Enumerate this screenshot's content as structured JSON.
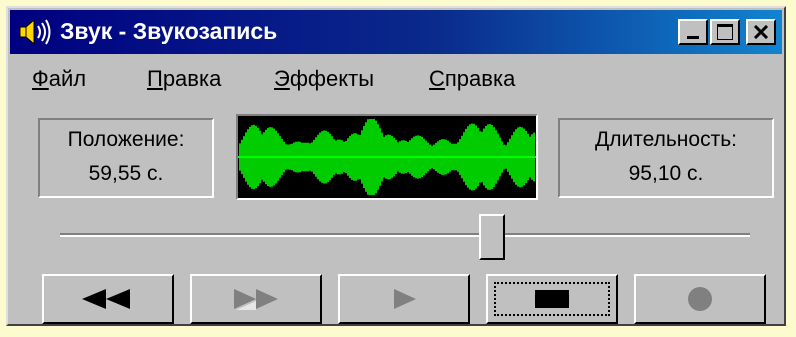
{
  "window": {
    "title": "Звук - Звукозапись",
    "controls": {
      "minimize": "minimize-icon",
      "maximize": "maximize-icon",
      "close": "close-icon"
    }
  },
  "menu": [
    {
      "accel": "Ф",
      "rest": "айл"
    },
    {
      "accel": "П",
      "rest": "равка"
    },
    {
      "accel": "Э",
      "rest": "ффекты"
    },
    {
      "accel": "С",
      "rest": "правка"
    }
  ],
  "position": {
    "label": "Положение:",
    "value": "59,55 с."
  },
  "length": {
    "label": "Длительность:",
    "value": "95,10 с."
  },
  "seek": {
    "fraction": 0.626
  },
  "waveform": {
    "color": "#00ff00",
    "background": "#000000"
  },
  "buttons": [
    {
      "name": "rewind",
      "icon": "rewind-icon",
      "enabled": true
    },
    {
      "name": "fast-forward",
      "icon": "fast-forward-icon",
      "enabled": false
    },
    {
      "name": "play",
      "icon": "play-icon",
      "enabled": false
    },
    {
      "name": "stop",
      "icon": "stop-icon",
      "enabled": true,
      "focused": true
    },
    {
      "name": "record",
      "icon": "record-icon",
      "enabled": false
    }
  ]
}
